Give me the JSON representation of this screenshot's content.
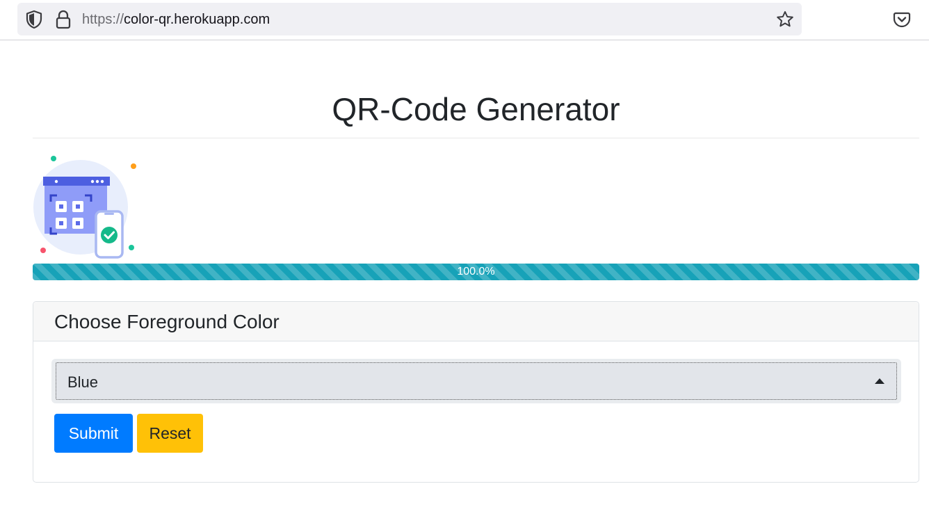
{
  "browser": {
    "url_scheme": "https://",
    "url_host": "color-qr.herokuapp.com",
    "icons": [
      "shield-icon",
      "lock-icon",
      "bookmark-star-icon",
      "pocket-icon"
    ]
  },
  "page": {
    "title": "QR-Code Generator",
    "illustration": "qr-scan-phone-illustration"
  },
  "progress": {
    "value": 1.0,
    "label": "100.0%",
    "color": "#17a2b8"
  },
  "card": {
    "header": "Choose Foreground Color",
    "select": {
      "selected": "Blue"
    },
    "buttons": {
      "submit_label": "Submit",
      "reset_label": "Reset"
    }
  },
  "colors": {
    "submit": "#007bff",
    "reset": "#ffc107",
    "illustration_accent": "#6f7ff5"
  }
}
